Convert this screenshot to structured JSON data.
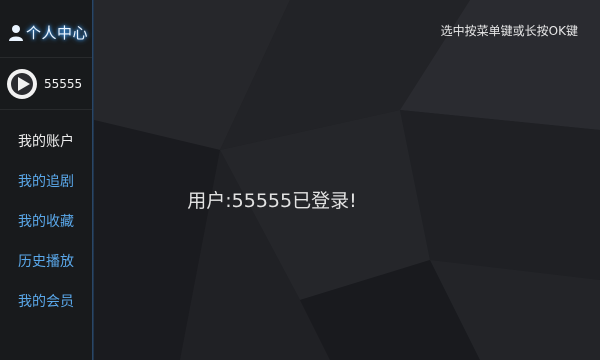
{
  "header": {
    "title": "个人中心",
    "hint": "选中按菜单键或长按OK键"
  },
  "user": {
    "name": "55555",
    "avatar_icon": "play-icon"
  },
  "sidebar": {
    "items": [
      {
        "label": "我的账户",
        "active": true
      },
      {
        "label": "我的追剧",
        "active": false
      },
      {
        "label": "我的收藏",
        "active": false
      },
      {
        "label": "历史播放",
        "active": false
      },
      {
        "label": "我的会员",
        "active": false
      }
    ]
  },
  "main": {
    "message": "用户:55555已登录!"
  },
  "colors": {
    "accent": "#5aa8ea",
    "glow": "#3da2ff",
    "background": "#1d1e22"
  }
}
